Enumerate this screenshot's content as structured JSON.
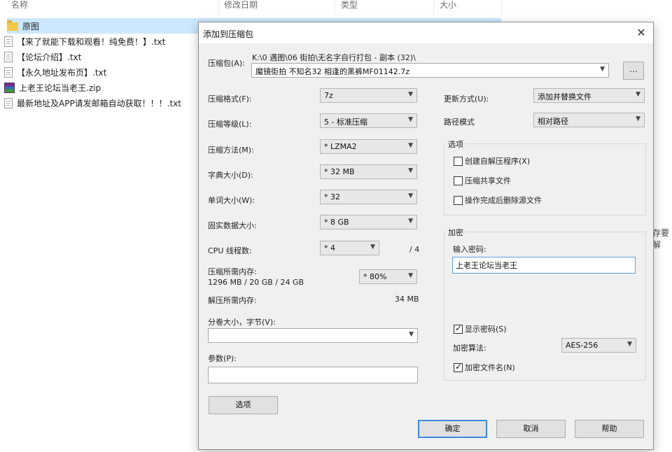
{
  "explorer": {
    "columns": {
      "name": "名称",
      "modified": "修改日期",
      "type": "类型",
      "size": "大小"
    },
    "files": [
      {
        "name": "原图",
        "icon": "folder-icon"
      },
      {
        "name": "【来了就能下载和观看！纯免费！】.txt",
        "icon": "txt-file-icon"
      },
      {
        "name": "【论坛介绍】.txt",
        "icon": "txt-file-icon"
      },
      {
        "name": "【永久地址发布页】.txt",
        "icon": "txt-file-icon"
      },
      {
        "name": "上老王论坛当老王.zip",
        "icon": "zip-file-icon"
      },
      {
        "name": "最新地址及APP请发邮箱自动获取！！！.txt",
        "icon": "txt-file-icon"
      }
    ],
    "right_clip_text": "存要解"
  },
  "dialog": {
    "title": "添加到压缩包",
    "close_glyph": "✕",
    "archive": {
      "label": "压缩包(A):",
      "path": "K:\\0 遇图\\06 街拍\\无名字自行打包 - 副本 (32)\\",
      "filename": "魔镜街拍 不知名32 相逢的黑裤MF01142.7z",
      "browse_label": "..."
    },
    "format": {
      "label": "压缩格式(F):",
      "value": "7z"
    },
    "level": {
      "label": "压缩等级(L):",
      "value": "5 - 标准压缩"
    },
    "method": {
      "label": "压缩方法(M):",
      "value": "* LZMA2"
    },
    "dict": {
      "label": "字典大小(D):",
      "value": "* 32 MB"
    },
    "word": {
      "label": "单词大小(W):",
      "value": "* 32"
    },
    "solid": {
      "label": "固实数据大小:",
      "value": "* 8 GB"
    },
    "cpu": {
      "label": "CPU 线程数:",
      "value": "* 4",
      "max": "/ 4"
    },
    "memcomp": {
      "label": "压缩所需内存:",
      "detail": "1296 MB / 20 GB / 24 GB",
      "value": "* 80%"
    },
    "memdecomp": {
      "label": "解压所需内存:",
      "value": "34 MB"
    },
    "split": {
      "label": "分卷大小，字节(V):",
      "value": ""
    },
    "params": {
      "label": "参数(P):",
      "value": ""
    },
    "options_button": "选项",
    "update": {
      "label": "更新方式(U):",
      "value": "添加并替换文件"
    },
    "pathmode": {
      "label": "路径模式",
      "value": "相对路径"
    },
    "options_group": {
      "title": "选项",
      "items": [
        {
          "label": "创建自解压程序(X)",
          "checked": false
        },
        {
          "label": "压缩共享文件",
          "checked": false
        },
        {
          "label": "操作完成后删除源文件",
          "checked": false
        }
      ]
    },
    "encryption": {
      "title": "加密",
      "password_label": "输入密码:",
      "password": "上老王论坛当老王",
      "show_password": {
        "label": "显示密码(S)",
        "checked": true
      },
      "method_label": "加密算法:",
      "method": "AES-256",
      "encrypt_names": {
        "label": "加密文件名(N)",
        "checked": true
      }
    },
    "buttons": {
      "ok": "确定",
      "cancel": "取消",
      "help": "帮助"
    }
  }
}
